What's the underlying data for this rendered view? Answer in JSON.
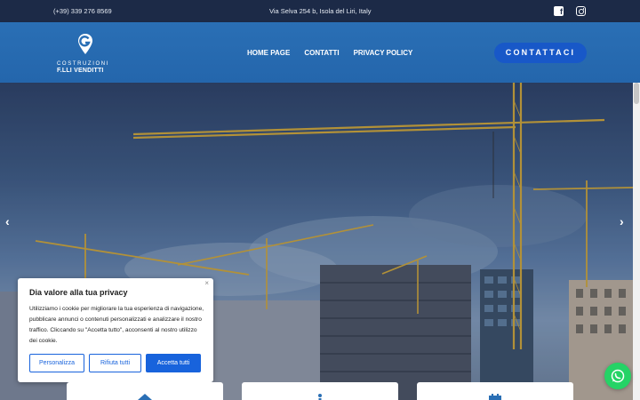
{
  "topbar": {
    "phone": "(+39) 339 276 8569",
    "address": "Via Selva 254 b, Isola del Liri, Italy",
    "icons": [
      "facebook-icon",
      "instagram-icon"
    ]
  },
  "brand": {
    "line1": "COSTRUZIONI",
    "line2": "F.LLI VENDITTI"
  },
  "nav": {
    "items": [
      {
        "label": "HOME PAGE"
      },
      {
        "label": "CONTATTI"
      },
      {
        "label": "PRIVACY POLICY"
      }
    ],
    "cta_label": "CONTATTACI"
  },
  "hero": {
    "prev_arrow": "‹",
    "next_arrow": "›"
  },
  "cookie": {
    "close": "×",
    "title": "Dia valore alla tua privacy",
    "text": "Utilizziamo i cookie per migliorare la tua esperienza di navigazione, pubblicare annunci o contenuti personalizzati e analizzare il nostro traffico. Cliccando su \"Accetta tutto\", acconsenti al nostro utilizzo dei cookie.",
    "customize_label": "Personalizza",
    "reject_label": "Rifiuta tutti",
    "accept_label": "Accetta tutti"
  },
  "colors": {
    "topbar": "#1c2a47",
    "header": "#2a6fb5",
    "cta": "#1858c8",
    "cookie_accent": "#1863dc",
    "whatsapp": "#25d366"
  }
}
